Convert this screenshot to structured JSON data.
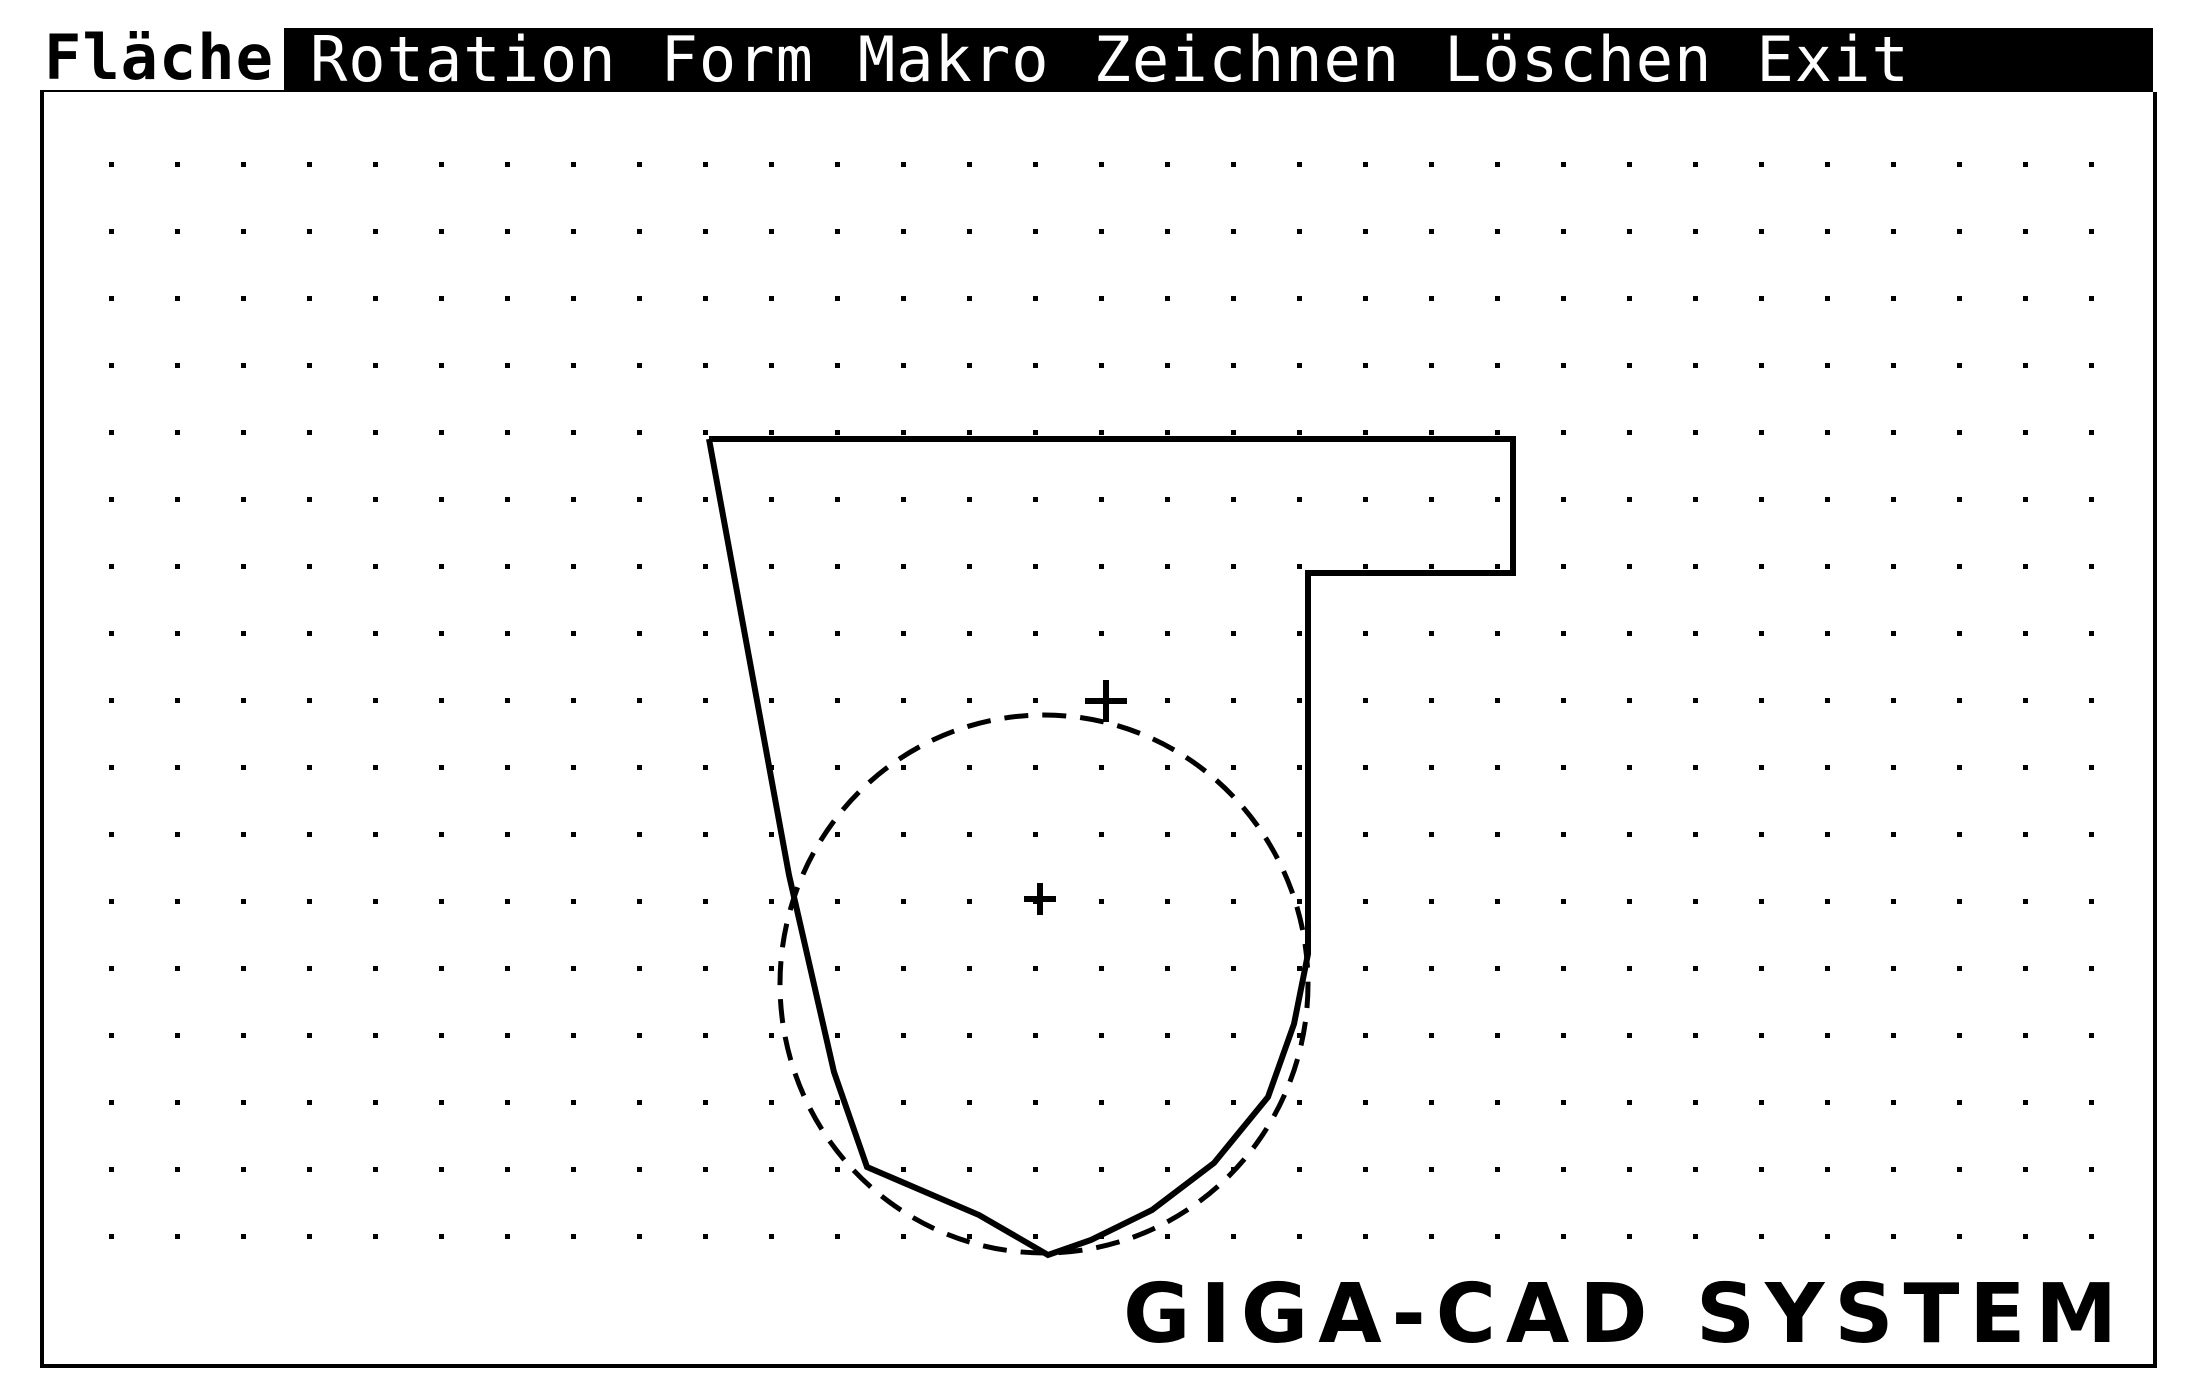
{
  "menu": {
    "items": [
      {
        "label": "Fläche",
        "active": true
      },
      {
        "label": "Rotation"
      },
      {
        "label": "Form"
      },
      {
        "label": "Makro"
      },
      {
        "label": "Zeichnen"
      },
      {
        "label": "Löschen"
      },
      {
        "label": "Exit"
      }
    ]
  },
  "canvas": {
    "grid": "dotted",
    "primitives": [
      {
        "kind": "polygon",
        "style": "solid",
        "role": "profile"
      },
      {
        "kind": "ellipse",
        "style": "dashed",
        "role": "rotation-ellipse"
      }
    ],
    "markers": [
      {
        "kind": "crosshair",
        "role": "upper-center"
      },
      {
        "kind": "crosshair",
        "role": "lower-center"
      }
    ]
  },
  "branding": {
    "logo_text": "GIGA-CAD SYSTEM"
  },
  "colors": {
    "foreground": "#000000",
    "background": "#ffffff"
  }
}
